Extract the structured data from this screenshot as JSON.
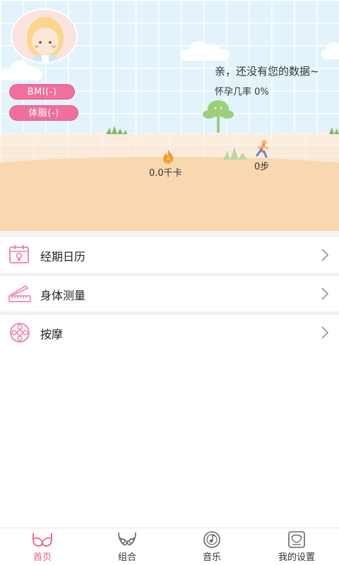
{
  "profile": {
    "bmi_label": "BMI(-)",
    "body_fat_label": "体脂(-)"
  },
  "status": {
    "message": "亲，还没有您的数据~",
    "pregnancy_rate": "怀孕几率 0%"
  },
  "activity": {
    "calories": "0.0千卡",
    "steps": "0步"
  },
  "menu": {
    "items": [
      {
        "label": "经期日历",
        "icon": "calendar-icon"
      },
      {
        "label": "身体测量",
        "icon": "ruler-icon"
      },
      {
        "label": "按摩",
        "icon": "massage-icon"
      }
    ]
  },
  "bottom_nav": {
    "items": [
      {
        "label": "首页",
        "icon": "bra-icon",
        "active": true
      },
      {
        "label": "组合",
        "icon": "combo-icon",
        "active": false
      },
      {
        "label": "音乐",
        "icon": "music-disc-icon",
        "active": false
      },
      {
        "label": "我的设置",
        "icon": "settings-icon",
        "active": false
      }
    ]
  },
  "colors": {
    "accent_pink": "#f06f9c",
    "active_tab": "#f05a7e",
    "sky": "#e3f3fb",
    "ground": "#f9d8b4"
  }
}
